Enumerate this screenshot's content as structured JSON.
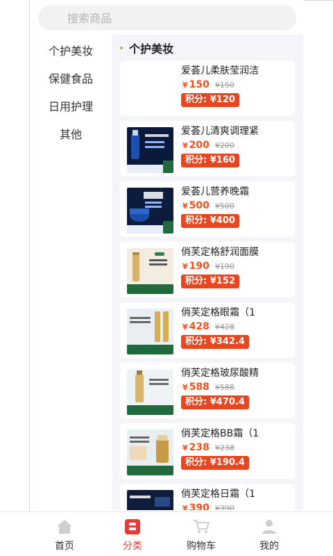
{
  "search": {
    "placeholder": "搜索商品"
  },
  "categories": [
    "个护美妆",
    "保健食品",
    "日用护理",
    "其他"
  ],
  "section": {
    "title": "个护美妆"
  },
  "currency": "¥",
  "products": [
    {
      "name": "爱荟儿柔肤莹润洁",
      "price": "150",
      "old_price": "¥150",
      "points": "积分: ¥120",
      "image": "none"
    },
    {
      "name": "爱荟儿清爽调理紧",
      "price": "200",
      "old_price": "¥200",
      "points": "积分: ¥160",
      "image": "blue-serum-bottle"
    },
    {
      "name": "爱荟儿营养晚霜",
      "price": "500",
      "old_price": "¥500",
      "points": "积分: ¥400",
      "image": "blue-cream-jar"
    },
    {
      "name": "俏芙定格舒润面膜",
      "price": "190",
      "old_price": "¥190",
      "points": "积分: ¥152",
      "image": "gold-tube"
    },
    {
      "name": "俏芙定格眼霜（1",
      "price": "428",
      "old_price": "¥428",
      "points": "积分: ¥342.4",
      "image": "gold-eye-cream"
    },
    {
      "name": "俏芙定格玻尿酸精",
      "price": "588",
      "old_price": "¥588",
      "points": "积分: ¥470.4",
      "image": "gold-serum-pump"
    },
    {
      "name": "俏芙定格BB霜（1",
      "price": "238",
      "old_price": "¥238",
      "points": "积分: ¥190.4",
      "image": "gold-bb-cream"
    },
    {
      "name": "俏芙定格日霜（1",
      "price": "390",
      "old_price": "¥390",
      "points": "",
      "image": "gold-day-cream"
    }
  ],
  "tabbar": [
    {
      "label": "首页",
      "icon": "home-icon",
      "active": false
    },
    {
      "label": "分类",
      "icon": "category-icon",
      "active": true
    },
    {
      "label": "购物车",
      "icon": "cart-icon",
      "active": false
    },
    {
      "label": "我的",
      "icon": "user-icon",
      "active": false
    }
  ],
  "colors": {
    "accent": "#e53935",
    "price": "#f2501e",
    "points_bg": "#e9461f",
    "panel_bg": "#f5f4f9"
  }
}
